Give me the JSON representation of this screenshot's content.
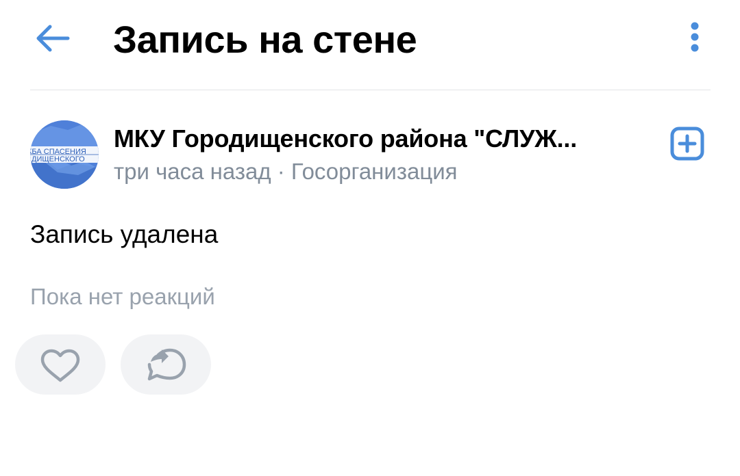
{
  "header": {
    "title": "Запись на стене",
    "back_icon": "arrow-left-icon",
    "more_icon": "more-vertical-icon",
    "accent_color": "#4a8ddb"
  },
  "post": {
    "author": {
      "name": "МКУ Городищенского района \"СЛУЖ...",
      "avatar_text_line1": "КБА СПАСЕНИЯ",
      "avatar_text_line2": "ДИЩЕНСКОГО",
      "time": "три часа назад",
      "separator": " · ",
      "type": "Госорганизация",
      "subscribe_icon": "plus-square-icon"
    },
    "text": "Запись удалена",
    "reactions_placeholder": "Пока нет реакций",
    "actions": [
      {
        "icon": "heart-icon"
      },
      {
        "icon": "share-icon"
      }
    ]
  },
  "colors": {
    "secondary_text": "#818c99",
    "placeholder_text": "#99a2ad",
    "button_bg": "#f2f3f5",
    "icon_gray": "#99a2ad"
  }
}
